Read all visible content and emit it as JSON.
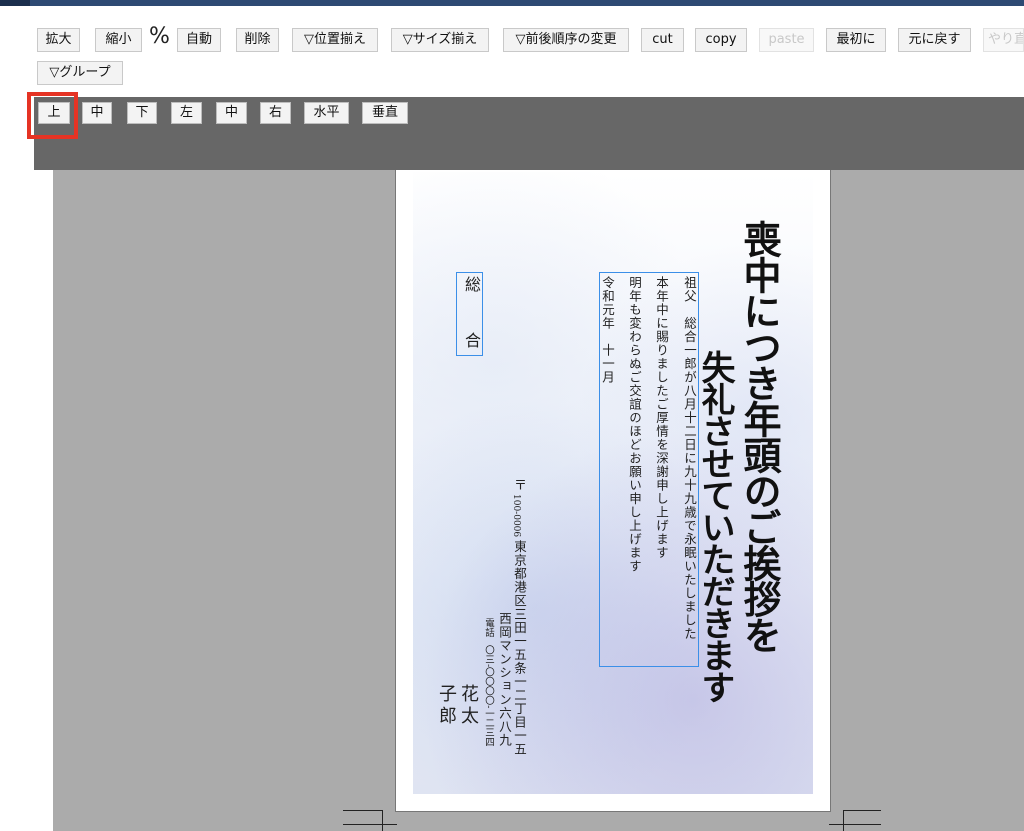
{
  "toolbar": {
    "row1": [
      "拡大",
      "縮小",
      "自動",
      "削除",
      "▽位置揃え",
      "▽サイズ揃え",
      "▽前後順序の変更",
      "cut",
      "copy",
      "paste",
      "最初に",
      "元に戻す",
      "やり直す"
    ],
    "zoom_symbol": "%",
    "row2": [
      "▽グループ"
    ]
  },
  "align_panel": {
    "buttons": [
      "上",
      "中",
      "下",
      "左",
      "中",
      "右",
      "水平",
      "垂直"
    ],
    "selected": "上"
  },
  "card": {
    "heading_line1": "喪中につき年頭のご挨拶を",
    "heading_line2": "失礼させていただきます",
    "message_lines": [
      "祖父　総合一郎が八月十二日に九十九歳で永眠いたしました",
      "本年中に賜りましたご厚情を深謝申し上げます",
      "明年も変わらぬご交誼のほどお願い申し上げます",
      "令和元年　十一月"
    ],
    "recipient_name": [
      "総",
      "合"
    ],
    "postal_mark": "〒",
    "postal_code": "100-0006",
    "address_line1": "東京都港区三田一五条一二丁目一五",
    "address_line2": "西岡マンション六八九",
    "phone_label": "電話",
    "phone": "〇三-〇〇〇〇-一二三四",
    "sender_given_1": "花太",
    "sender_given_2": "子郎"
  },
  "colors": {
    "accent": "#2d4a73",
    "panel": "#676767",
    "canvas": "#ababab",
    "selection": "#3b8fe8",
    "highlight": "#e53324"
  }
}
